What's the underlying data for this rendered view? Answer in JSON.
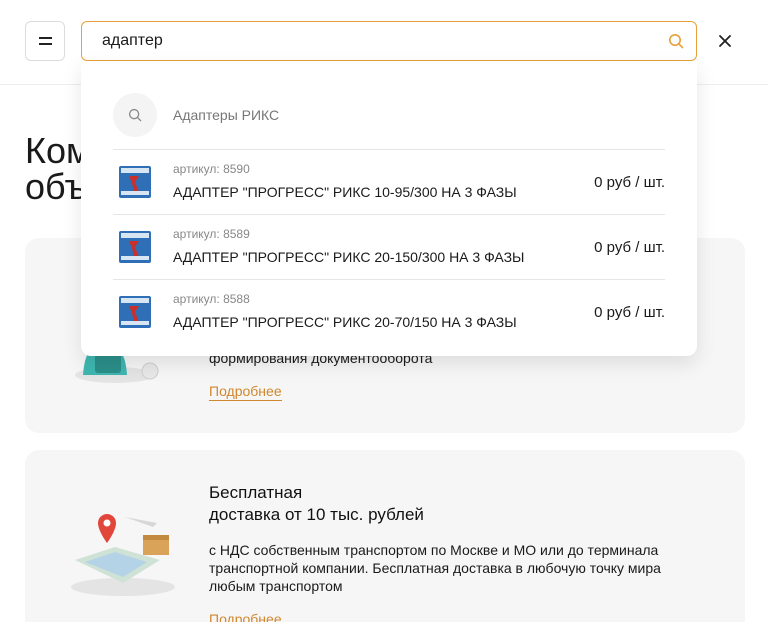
{
  "search": {
    "value": "адаптер"
  },
  "page": {
    "title_line1": "Ком",
    "title_line2": "объ"
  },
  "cards": [
    {
      "text_partial": "формирования документооборота",
      "link": "Подробнее"
    },
    {
      "heading_line1": "Бесплатная",
      "heading_line2": "доставка от 10 тыс. рублей",
      "text": "с НДС собственным транспортом по Москве и МО или до терминала транспортной компании. Бесплатная доставка в любочую точку мира любым транспортом",
      "link": "Подробнее"
    }
  ],
  "dropdown": {
    "suggestion": "Адаптеры РИКС",
    "products": [
      {
        "article": "артикул: 8590",
        "name": "АДАПТЕР \"ПРОГРЕСС\" РИКС 10-95/300 НА 3 ФАЗЫ",
        "price": "0 руб / шт."
      },
      {
        "article": "артикул: 8589",
        "name": "АДАПТЕР \"ПРОГРЕСС\" РИКС 20-150/300 НА 3 ФАЗЫ",
        "price": "0 руб / шт."
      },
      {
        "article": "артикул: 8588",
        "name": "АДАПТЕР \"ПРОГРЕСС\" РИКС 20-70/150 НА 3 ФАЗЫ",
        "price": "0 руб / шт."
      }
    ]
  },
  "icons": {
    "menu": "menu-icon",
    "search": "search-icon",
    "close": "close-icon"
  },
  "colors": {
    "accent": "#e8a13a",
    "link": "#d0872e",
    "card_bg": "#f6f6f6"
  }
}
